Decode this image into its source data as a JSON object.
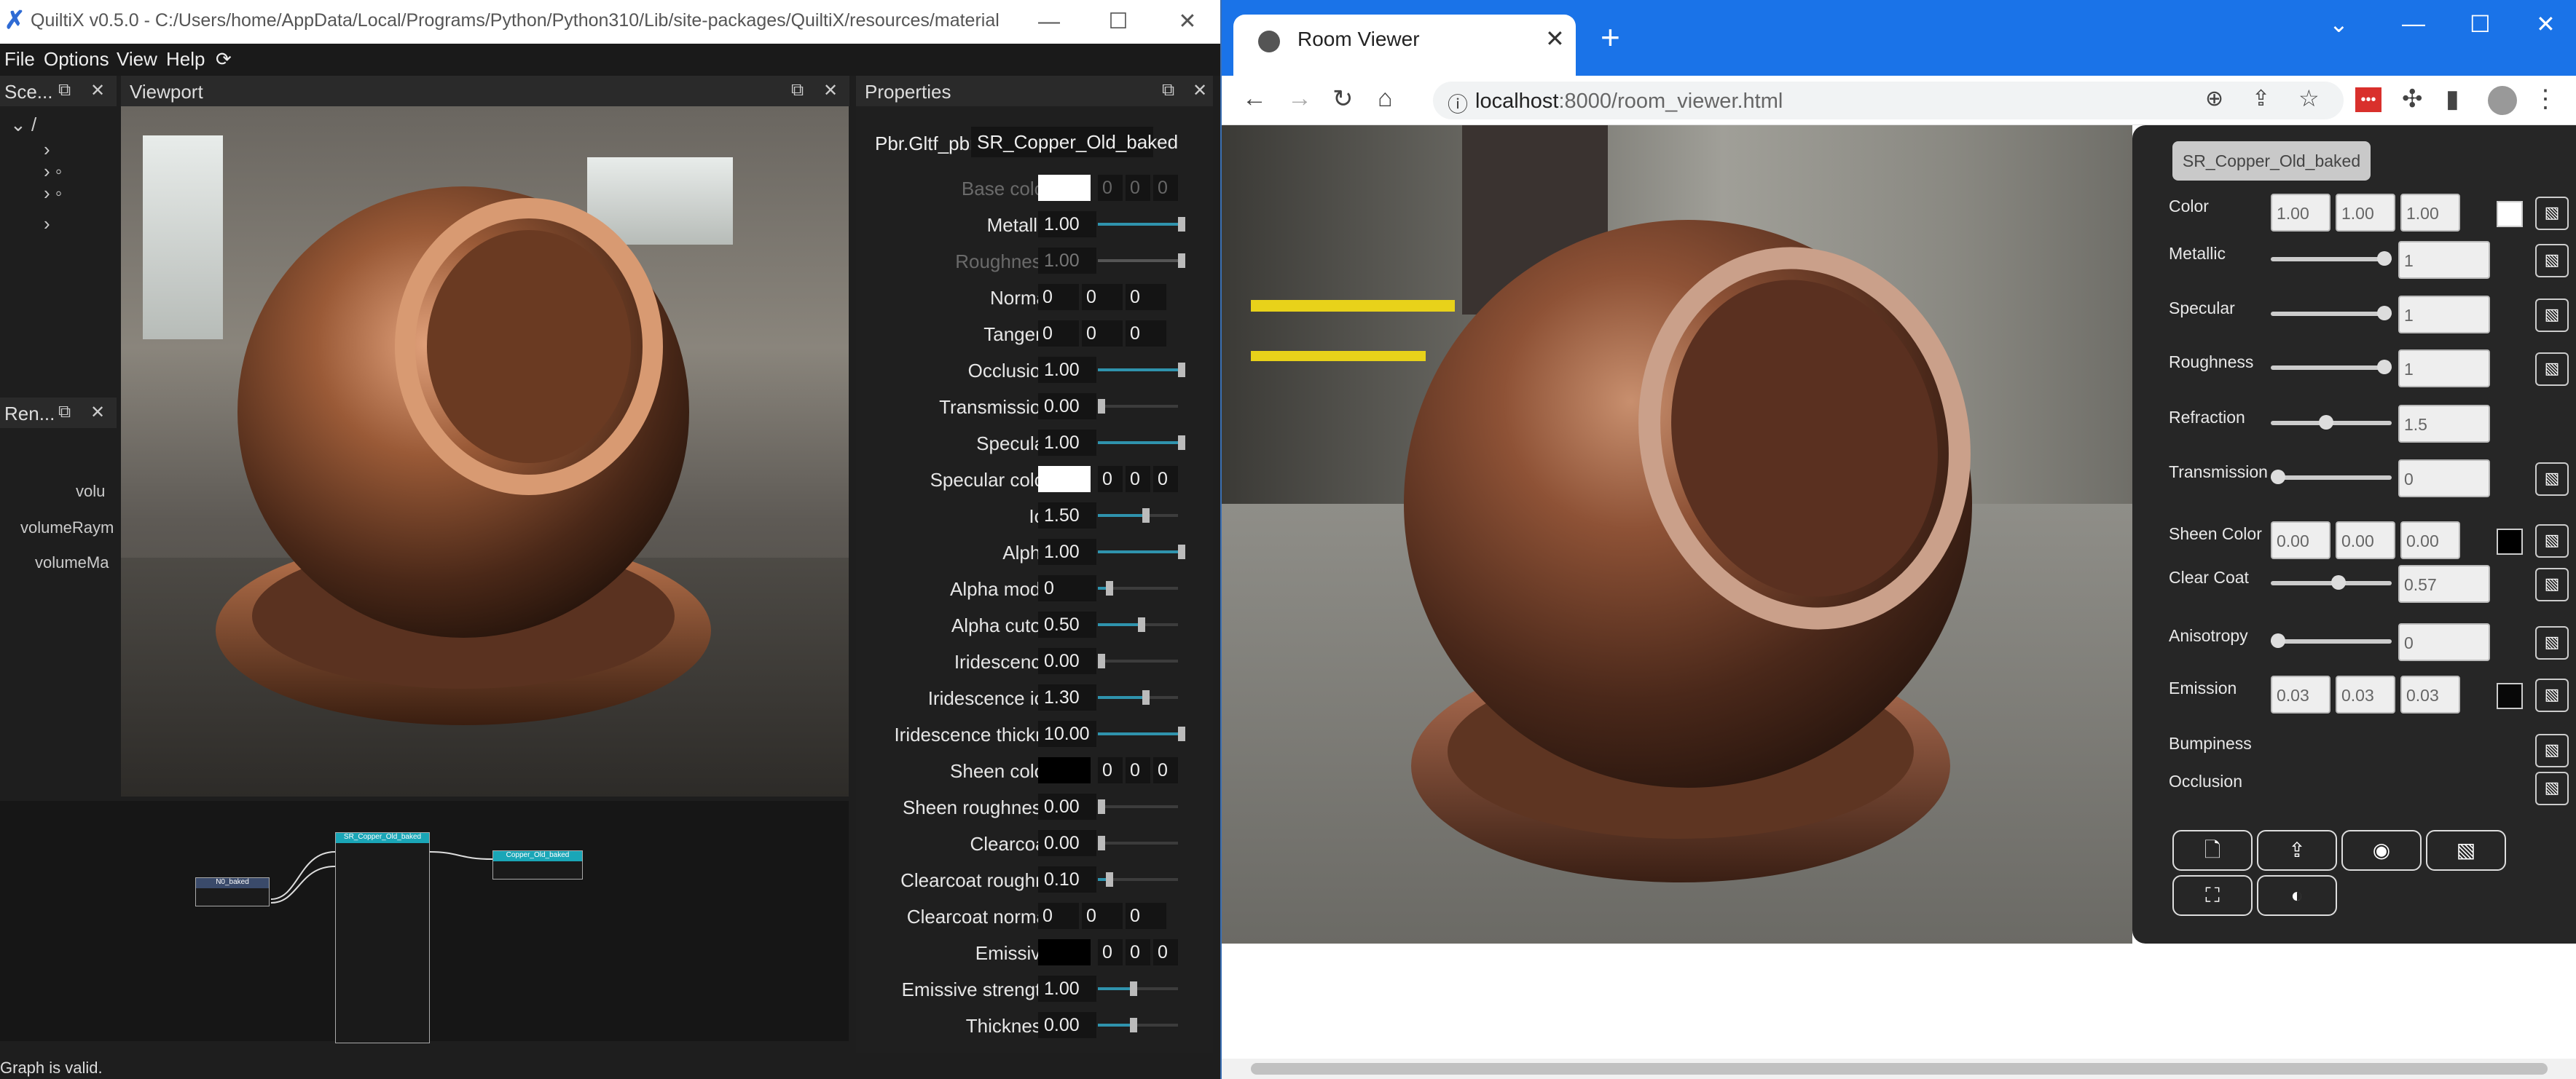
{
  "left_app": {
    "title": "QuiltiX v0.5.0 - C:/Users/home/AppData/Local/Programs/Python/Python310/Lib/site-packages/QuiltiX/resources/materials/Co...",
    "menu": [
      "File",
      "Options",
      "View",
      "Help"
    ],
    "panels": {
      "scene_title": "Sce...",
      "viewport_title": "Viewport",
      "properties_title": "Properties",
      "render_title": "Ren..."
    },
    "scene_tree": {
      "root": "/"
    },
    "render_items": [
      "volu",
      "volumeRaym",
      "volumeMa"
    ],
    "properties": {
      "material_type": "Pbr.Gltf_pbr",
      "material_name": "SR_Copper_Old_baked",
      "rows": [
        {
          "label": "Base color:",
          "kind": "color",
          "color": "#ffffff",
          "vec": [
            "0",
            "0",
            "0"
          ],
          "dim": true
        },
        {
          "label": "Metallic:",
          "kind": "slider",
          "value": "1.00",
          "fill": 1.0
        },
        {
          "label": "Roughness:",
          "kind": "slider",
          "value": "1.00",
          "fill": 1.0,
          "dim": true
        },
        {
          "label": "Normal:",
          "kind": "vec",
          "vec": [
            "0",
            "0",
            "0"
          ]
        },
        {
          "label": "Tangent:",
          "kind": "vec",
          "vec": [
            "0",
            "0",
            "0"
          ]
        },
        {
          "label": "Occlusion:",
          "kind": "slider",
          "value": "1.00",
          "fill": 1.0
        },
        {
          "label": "Transmission:",
          "kind": "slider",
          "value": "0.00",
          "fill": 0.0
        },
        {
          "label": "Specular:",
          "kind": "slider",
          "value": "1.00",
          "fill": 1.0
        },
        {
          "label": "Specular color:",
          "kind": "color",
          "color": "#ffffff",
          "vec": [
            "0",
            "0",
            "0"
          ]
        },
        {
          "label": "Ior:",
          "kind": "slider",
          "value": "1.50",
          "fill": 0.55
        },
        {
          "label": "Alpha:",
          "kind": "slider",
          "value": "1.00",
          "fill": 1.0
        },
        {
          "label": "Alpha mode:",
          "kind": "slider",
          "value": "0",
          "fill": 0.1
        },
        {
          "label": "Alpha cutoff:",
          "kind": "slider",
          "value": "0.50",
          "fill": 0.5
        },
        {
          "label": "Iridescence:",
          "kind": "slider",
          "value": "0.00",
          "fill": 0.0
        },
        {
          "label": "Iridescence ior:",
          "kind": "slider",
          "value": "1.30",
          "fill": 0.55
        },
        {
          "label": "Iridescence thickne",
          "kind": "slider",
          "value": "10.00",
          "fill": 1.0
        },
        {
          "label": "Sheen color:",
          "kind": "color",
          "color": "#000000",
          "vec": [
            "0",
            "0",
            "0"
          ]
        },
        {
          "label": "Sheen roughness:",
          "kind": "slider",
          "value": "0.00",
          "fill": 0.0
        },
        {
          "label": "Clearcoat:",
          "kind": "slider",
          "value": "0.00",
          "fill": 0.0
        },
        {
          "label": "Clearcoat roughne",
          "kind": "slider",
          "value": "0.10",
          "fill": 0.1
        },
        {
          "label": "Clearcoat normal:",
          "kind": "vec",
          "vec": [
            "0",
            "0",
            "0"
          ]
        },
        {
          "label": "Emissive:",
          "kind": "color",
          "color": "#000000",
          "vec": [
            "0",
            "0",
            "0"
          ]
        },
        {
          "label": "Emissive strength:",
          "kind": "slider",
          "value": "1.00",
          "fill": 0.4
        },
        {
          "label": "Thickness:",
          "kind": "slider",
          "value": "0.00",
          "fill": 0.4
        }
      ]
    },
    "nodes": {
      "n1": "N0_baked",
      "n2": "SR_Copper_Old_baked",
      "n3": "Copper_Old_baked"
    },
    "status": "Graph is valid."
  },
  "browser": {
    "tab_title": "Room Viewer",
    "url_host": "localhost",
    "url_rest": ":8000/room_viewer.html",
    "material_name": "SR_Copper_Old_baked",
    "rows": [
      {
        "label": "Color",
        "kind": "rgb",
        "vals": [
          "1.00",
          "1.00",
          "1.00"
        ],
        "swatch": "#ffffff"
      },
      {
        "label": "Metallic",
        "kind": "slider",
        "val": "1",
        "pos": 1.0
      },
      {
        "label": "Specular",
        "kind": "slider",
        "val": "1",
        "pos": 1.0
      },
      {
        "label": "Roughness",
        "kind": "slider",
        "val": "1",
        "pos": 1.0
      },
      {
        "label": "Refraction",
        "kind": "slider-noimg",
        "val": "1.5",
        "pos": 0.45
      },
      {
        "label": "Transmission",
        "kind": "slider",
        "val": "0",
        "pos": 0.0
      },
      {
        "label": "Sheen Color",
        "kind": "rgb",
        "vals": [
          "0.00",
          "0.00",
          "0.00"
        ],
        "swatch": "#000000"
      },
      {
        "label": "Clear Coat",
        "kind": "slider",
        "val": "0.57",
        "pos": 0.57
      },
      {
        "label": "Anisotropy",
        "kind": "slider",
        "val": "0",
        "pos": 0.0
      },
      {
        "label": "Emission",
        "kind": "rgb",
        "vals": [
          "0.03",
          "0.03",
          "0.03"
        ],
        "swatch": "#080808"
      },
      {
        "label": "Bumpiness",
        "kind": "img"
      },
      {
        "label": "Occlusion",
        "kind": "img"
      }
    ]
  }
}
